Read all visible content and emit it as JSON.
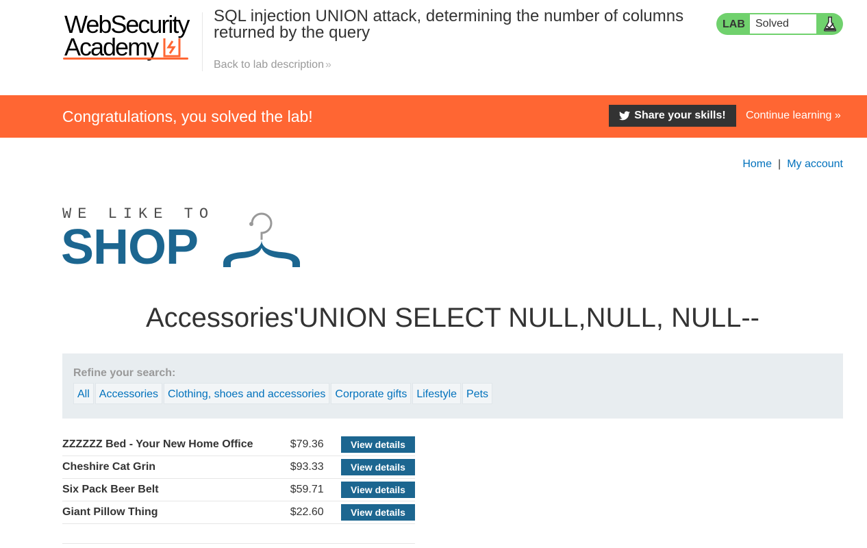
{
  "header": {
    "logo_line1": "WebSecurity",
    "logo_line2": "Academy",
    "lab_title": "SQL injection UNION attack, determining the number of columns returned by the query",
    "back_link": "Back to lab description",
    "lab_badge": {
      "tag": "LAB",
      "status": "Solved",
      "color": "#70d16d"
    }
  },
  "banner": {
    "message": "Congratulations, you solved the lab!",
    "share_label": "Share your skills!",
    "continue_label": "Continue learning",
    "color": "#ff6633"
  },
  "nav": {
    "home": "Home",
    "separator": "|",
    "account": "My account"
  },
  "shop_logo": {
    "tagline": "WE LIKE TO",
    "word": "SHOP"
  },
  "heading": "Accessories'UNION SELECT NULL,NULL, NULL--",
  "filter": {
    "label": "Refine your search:",
    "categories": [
      "All",
      "Accessories",
      "Clothing, shoes and accessories",
      "Corporate gifts",
      "Lifestyle",
      "Pets"
    ]
  },
  "products": [
    {
      "name": "ZZZZZZ Bed - Your New Home Office",
      "price": "$79.36",
      "action": "View details"
    },
    {
      "name": "Cheshire Cat Grin",
      "price": "$93.33",
      "action": "View details"
    },
    {
      "name": "Six Pack Beer Belt",
      "price": "$59.71",
      "action": "View details"
    },
    {
      "name": "Giant Pillow Thing",
      "price": "$22.60",
      "action": "View details"
    }
  ],
  "colors": {
    "accent": "#ff6633",
    "link": "#0071bc",
    "button": "#1c6690"
  }
}
